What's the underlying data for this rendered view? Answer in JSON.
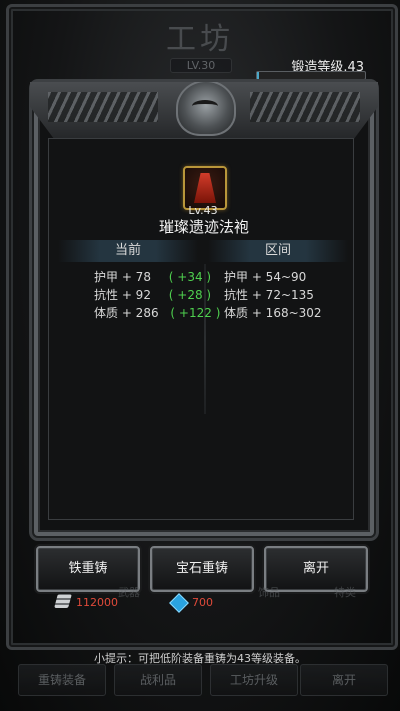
{
  "workshop": {
    "title": "工坊",
    "level_badge": "LV.30",
    "forge_level_label": "锻造等级.43",
    "forge_progress": 0.02,
    "forge_sub_label": "锻造等级"
  },
  "dialog": {
    "item": {
      "level": "Lv.43",
      "name": "璀璨遗迹法袍",
      "icon": "red-robe-icon"
    },
    "current_header": "当前",
    "range_header": "区间",
    "current_stats": [
      {
        "label": "护甲 + 78",
        "bonus": "( +34 )"
      },
      {
        "label": "抗性 + 92",
        "bonus": "( +28 )"
      },
      {
        "label": "体质 + 286",
        "bonus": "( +122 )"
      }
    ],
    "range_stats": [
      {
        "label": "护甲 + 54~90"
      },
      {
        "label": "抗性 + 72~135"
      },
      {
        "label": "体质 + 168~302"
      }
    ]
  },
  "buttons": {
    "iron_recast": "铁重铸",
    "gem_recast": "宝石重铸",
    "leave": "离开"
  },
  "currency": {
    "iron": "112000",
    "gem": "700",
    "ghost_weapon": "武器",
    "ghost_ornament": "饰品",
    "ghost_other": "特类"
  },
  "hint": "小提示：可把低阶装备重铸为43等级装备。",
  "tabs": {
    "recast": "重铸装备",
    "loot": "战利品",
    "upgrade": "工坊升级",
    "leave": "离开"
  },
  "colors": {
    "bonus_green": "#4fd04f",
    "currency_red": "#e04a3a",
    "progress_blue": "#4aa7c8"
  }
}
